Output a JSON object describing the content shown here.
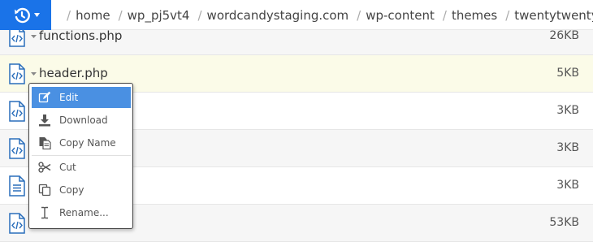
{
  "breadcrumb": {
    "items": [
      "home",
      "wp_pj5vt4",
      "wordcandystaging.com",
      "wp-content",
      "themes",
      "twentytwenty"
    ]
  },
  "files": [
    {
      "name": "functions.php",
      "size": "26KB",
      "icon": "code-file-icon"
    },
    {
      "name": "header.php",
      "size": "5KB",
      "icon": "code-file-icon"
    },
    {
      "name": "",
      "size": "3KB",
      "icon": "code-file-icon"
    },
    {
      "name": "",
      "size": "3KB",
      "icon": "code-file-icon"
    },
    {
      "name": "",
      "size": "3KB",
      "icon": "text-file-icon"
    },
    {
      "name": "",
      "size": "53KB",
      "icon": "code-file-icon"
    }
  ],
  "context_menu": {
    "items": [
      {
        "label": "Edit",
        "icon": "edit-icon",
        "active": true
      },
      {
        "label": "Download",
        "icon": "download-icon"
      },
      {
        "label": "Copy Name",
        "icon": "copy-name-icon"
      },
      {
        "label": "Cut",
        "icon": "scissors-icon"
      },
      {
        "label": "Copy",
        "icon": "copy-icon"
      },
      {
        "label": "Rename...",
        "icon": "text-cursor-icon"
      }
    ]
  },
  "colors": {
    "accent": "#1a73e8",
    "menu_highlight": "#4a90e2",
    "selected_row": "#fbfbe8"
  }
}
